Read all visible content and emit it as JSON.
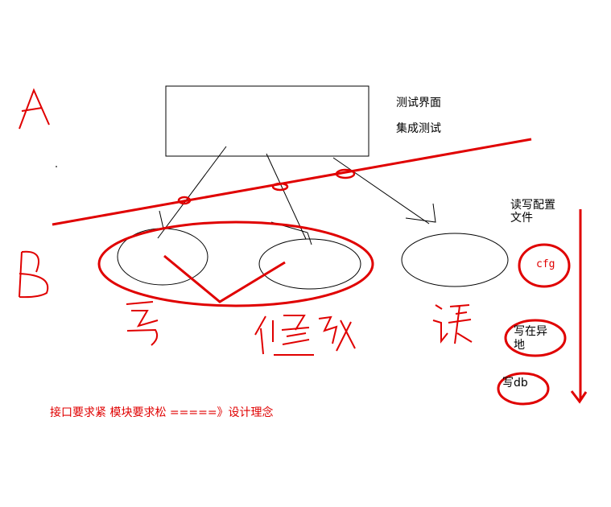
{
  "ui_box_labels": {
    "line1": "测试界面",
    "line2": "集成测试"
  },
  "layer_labels": {
    "a": "A",
    "b": "B"
  },
  "handwritten": {
    "write": "写",
    "modify": "修改",
    "read": "读"
  },
  "config_note": {
    "line1": "读写配置",
    "line2": "文件"
  },
  "storage_targets": {
    "cfg": "cfg",
    "remote_line1": "写在异",
    "remote_line2": "地",
    "db": "写db"
  },
  "principle": "接口要求紧  模块要求松 =====》设计理念",
  "colors": {
    "ink": "#000000",
    "annotation": "#e00000",
    "background": "#ffffff"
  }
}
